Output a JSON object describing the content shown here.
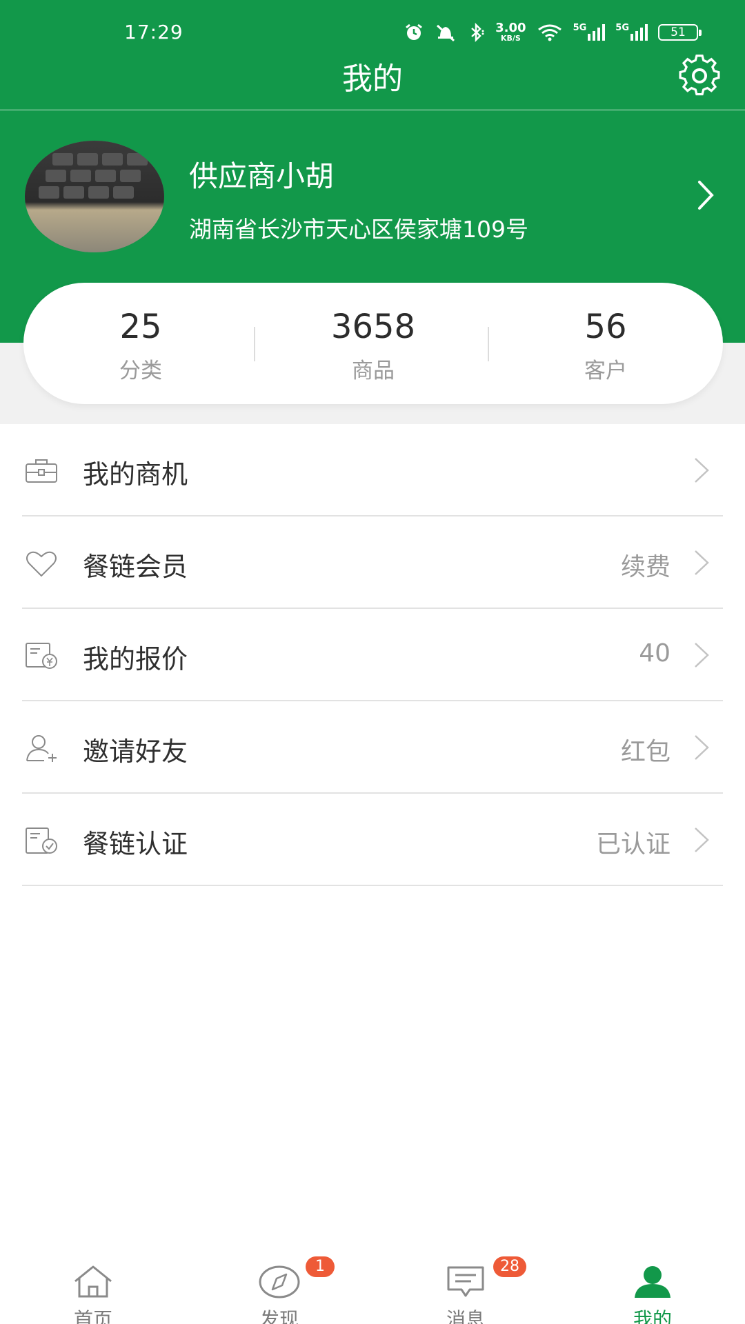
{
  "status_bar": {
    "time": "17:29",
    "net_speed_value": "3.00",
    "net_speed_unit": "KB/S",
    "signal1": "5G",
    "signal2": "5G",
    "battery": "51"
  },
  "header": {
    "title": "我的",
    "settings_icon": "gear-icon"
  },
  "profile": {
    "name": "供应商小胡",
    "address": "湖南省长沙市天心区侯家塘109号"
  },
  "stats": [
    {
      "value": "25",
      "label": "分类"
    },
    {
      "value": "3658",
      "label": "商品"
    },
    {
      "value": "56",
      "label": "客户"
    }
  ],
  "menu": [
    {
      "label": "我的商机",
      "right": "",
      "icon": "briefcase-icon"
    },
    {
      "label": "餐链会员",
      "right": "续费",
      "icon": "heart-icon"
    },
    {
      "label": "我的报价",
      "right": "40",
      "icon": "quote-icon"
    },
    {
      "label": "邀请好友",
      "right": "红包",
      "icon": "add-user-icon"
    },
    {
      "label": "餐链认证",
      "right": "已认证",
      "icon": "certificate-icon"
    }
  ],
  "tabs": [
    {
      "label": "首页",
      "icon": "home-icon",
      "badge": ""
    },
    {
      "label": "发现",
      "icon": "compass-icon",
      "badge": "1"
    },
    {
      "label": "消息",
      "icon": "message-icon",
      "badge": "28"
    },
    {
      "label": "我的",
      "icon": "user-icon",
      "badge": ""
    }
  ],
  "colors": {
    "brand": "#12984a",
    "badge": "#ee5a37"
  }
}
